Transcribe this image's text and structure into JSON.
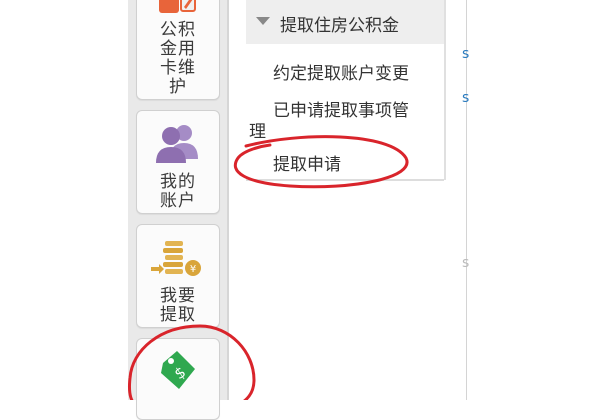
{
  "sidebar": {
    "items": [
      {
        "name": "fund-card-maintenance",
        "label_lines": [
          "公积",
          "金用",
          "卡维",
          "护"
        ]
      },
      {
        "name": "my-account",
        "label_lines": [
          "我的",
          "账户"
        ]
      },
      {
        "name": "want-withdraw",
        "label_lines": [
          "我要",
          "提取"
        ]
      },
      {
        "name": "loan",
        "label_lines": []
      }
    ]
  },
  "submenu": {
    "header": "提取住房公积金",
    "items": [
      "约定提取账户变更",
      "已申请提取事项管",
      "理",
      "提取申请"
    ]
  },
  "right_edge": {
    "glyphs": [
      "s",
      "s",
      "s"
    ]
  },
  "colors": {
    "annotation_red": "#d9242b",
    "icon_purple": "#8e6fb0",
    "icon_gold": "#d9a53a",
    "icon_green": "#2fa84f",
    "icon_orange": "#e8643a"
  }
}
